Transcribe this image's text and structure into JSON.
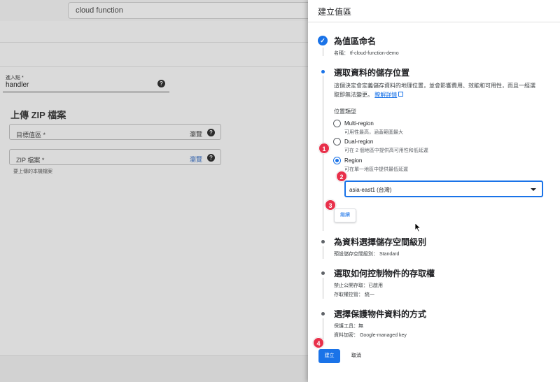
{
  "background": {
    "search_value": "cloud function",
    "entry_point": {
      "label": "進入點 *",
      "value": "handler"
    },
    "zip_section_title": "上傳 ZIP 檔案",
    "target_bucket": {
      "label": "目標值區 *",
      "action": "瀏覽"
    },
    "zip_file": {
      "label": "ZIP 檔案 *",
      "action": "瀏覽",
      "hint": "要上傳的本機檔案"
    },
    "help_icon": "?"
  },
  "panel": {
    "title": "建立值區",
    "step1": {
      "title": "為值區命名",
      "name_label": "名稱：",
      "name_value": "tf-cloud-function-demo",
      "icon": "check-icon"
    },
    "step2": {
      "title": "選取資料的儲存位置",
      "desc_line1": "這個決定會定義儲存資料的地理位置，並會影響費用、效能和可用性，而且一經選",
      "desc_line2": "取即無法變更。",
      "learn_more": "瞭解詳情",
      "location_type_label": "位置類型",
      "options": [
        {
          "label": "Multi-region",
          "sub": "可用性最高，涵蓋範圍最大"
        },
        {
          "label": "Dual-region",
          "sub": "可在 2 個地區中提供高可用性和低延遲"
        },
        {
          "label": "Region",
          "sub": "可在單一地區中提供最低延遲"
        }
      ],
      "selected_option": "Region",
      "region_value": "asia-east1 (台灣)",
      "continue_label": "繼續"
    },
    "step3": {
      "title": "為資料選擇儲存空間級別",
      "line": "預設儲存空間級別： Standard"
    },
    "step4": {
      "title": "選取如何控制物件的存取權",
      "line1": "禁止公開存取：已啟用",
      "line2": "存取權控管： 統一"
    },
    "step5": {
      "title": "選擇保護物件資料的方式",
      "line1": "保護工具：無",
      "line2": "資料加密： Google-managed key"
    },
    "create_label": "建立",
    "cancel_label": "取消"
  },
  "step_badges": [
    "1",
    "2",
    "3",
    "4"
  ],
  "colors": {
    "accent": "#1a73e8",
    "badge": "#e8304a",
    "overlay": "#dadada"
  }
}
